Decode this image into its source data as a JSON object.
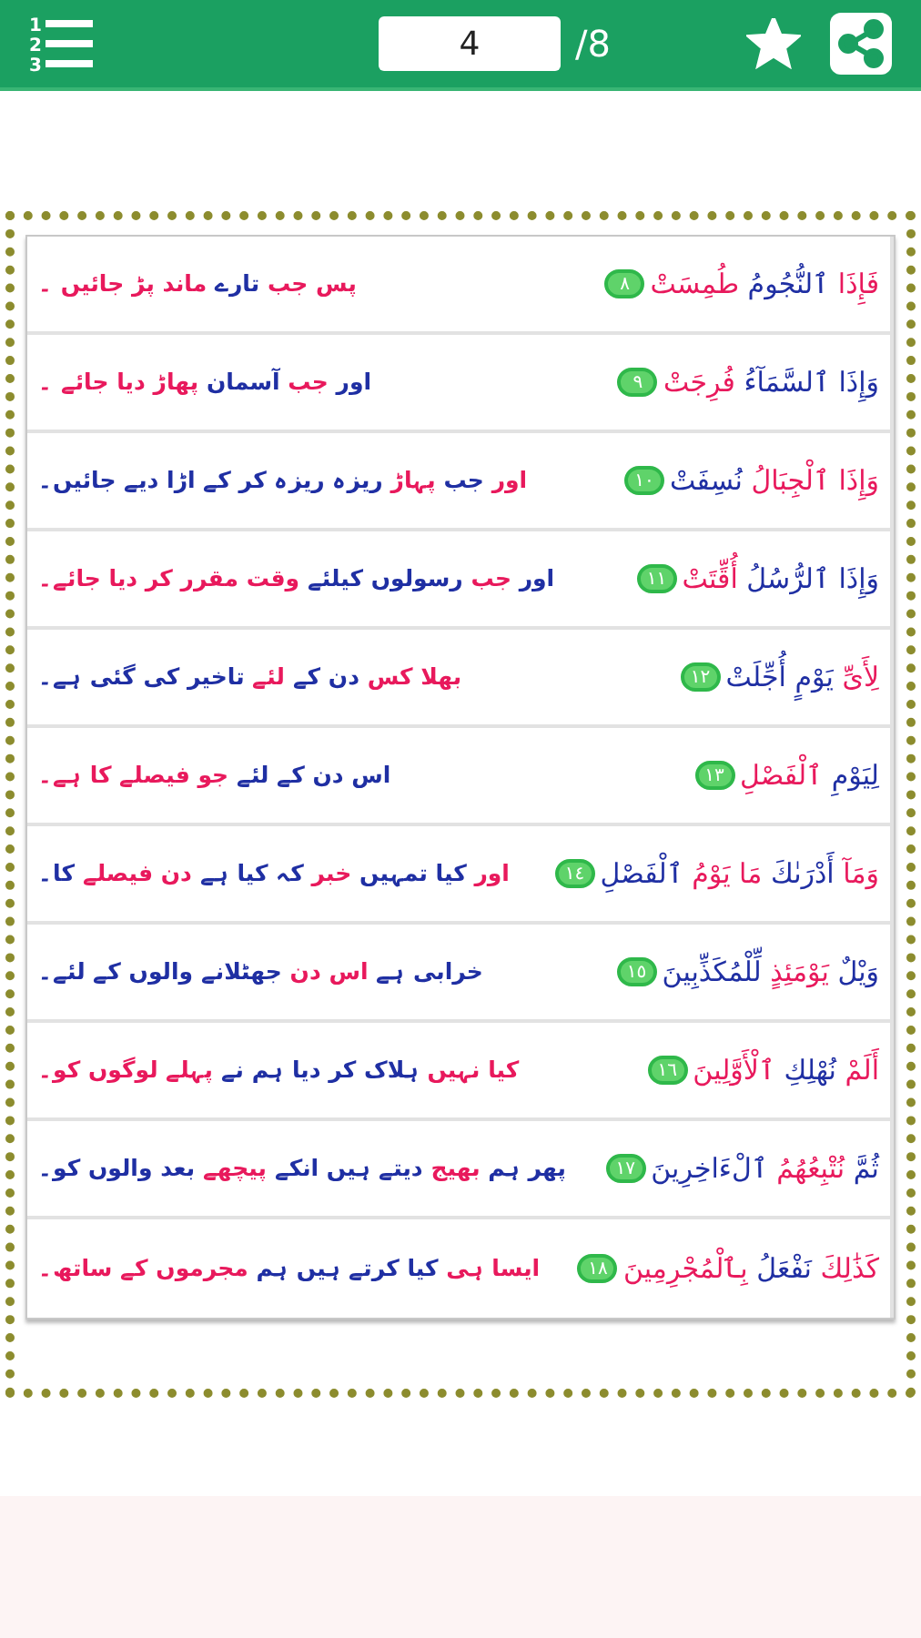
{
  "toolbar": {
    "menu_icon_digits": [
      "1",
      "2",
      "3"
    ],
    "page_field": {
      "value": "4"
    },
    "page_total": "/8",
    "favorite": {
      "on": true
    }
  },
  "verses": [
    {
      "number": "٨",
      "arabic": [
        {
          "text": "فَإِذَا",
          "color": "#e8195c"
        },
        {
          "text": "ٱلنُّجُومُ",
          "color": "#1f2fa3"
        },
        {
          "text": "طُمِسَتْ",
          "color": "#e8195c"
        }
      ],
      "urdu": [
        {
          "text": "پس جب",
          "color": "#e8195c"
        },
        {
          "text": "تارے",
          "color": "#1f2fa3"
        },
        {
          "text": "ماند پڑ جائیں ۔",
          "color": "#e8195c"
        }
      ]
    },
    {
      "number": "٩",
      "arabic": [
        {
          "text": "وَإِذَا",
          "color": "#1f2fa3"
        },
        {
          "text": "ٱلسَّمَآءُ",
          "color": "#1f2fa3"
        },
        {
          "text": "فُرِجَتْ",
          "color": "#e8195c"
        }
      ],
      "urdu": [
        {
          "text": "اور",
          "color": "#1f2fa3"
        },
        {
          "text": "جب",
          "color": "#e8195c"
        },
        {
          "text": "آسمان",
          "color": "#1f2fa3"
        },
        {
          "text": "پھاڑ دیا جائے ۔",
          "color": "#e8195c"
        }
      ]
    },
    {
      "number": "١٠",
      "arabic": [
        {
          "text": "وَإِذَا",
          "color": "#e8195c"
        },
        {
          "text": "ٱلْجِبَالُ",
          "color": "#e8195c"
        },
        {
          "text": "نُسِفَتْ",
          "color": "#1f2fa3"
        }
      ],
      "urdu": [
        {
          "text": "اور",
          "color": "#e8195c"
        },
        {
          "text": "جب",
          "color": "#1f2fa3"
        },
        {
          "text": "پہاڑ",
          "color": "#e8195c"
        },
        {
          "text": "ریزہ ریزہ کر کے اڑا دیے جائیں۔",
          "color": "#1f2fa3"
        }
      ]
    },
    {
      "number": "١١",
      "arabic": [
        {
          "text": "وَإِذَا",
          "color": "#1f2fa3"
        },
        {
          "text": "ٱلرُّسُلُ",
          "color": "#1f2fa3"
        },
        {
          "text": "أُقِّتَتْ",
          "color": "#e8195c"
        }
      ],
      "urdu": [
        {
          "text": "اور",
          "color": "#1f2fa3"
        },
        {
          "text": "جب",
          "color": "#e8195c"
        },
        {
          "text": "رسولوں کیلئے",
          "color": "#1f2fa3"
        },
        {
          "text": "وقت مقرر کر دیا جائے۔",
          "color": "#e8195c"
        }
      ]
    },
    {
      "number": "١٢",
      "arabic": [
        {
          "text": "لِأَىِّ",
          "color": "#e8195c"
        },
        {
          "text": "يَوْمٍ",
          "color": "#1f2fa3"
        },
        {
          "text": "أُجِّلَتْ",
          "color": "#1f2fa3"
        }
      ],
      "urdu": [
        {
          "text": "بھلا کس",
          "color": "#e8195c"
        },
        {
          "text": "دن کے",
          "color": "#1f2fa3"
        },
        {
          "text": "لئے",
          "color": "#e8195c"
        },
        {
          "text": "تاخیر کی گئی ہے۔",
          "color": "#1f2fa3"
        }
      ]
    },
    {
      "number": "١٣",
      "arabic": [
        {
          "text": "لِيَوْمِ",
          "color": "#1f2fa3"
        },
        {
          "text": "ٱلْفَصْلِ",
          "color": "#e8195c"
        }
      ],
      "urdu": [
        {
          "text": "اس دن کے لئے",
          "color": "#1f2fa3"
        },
        {
          "text": "جو فیصلے کا ہے۔",
          "color": "#e8195c"
        }
      ]
    },
    {
      "number": "١٤",
      "arabic": [
        {
          "text": "وَمَآ",
          "color": "#e8195c"
        },
        {
          "text": "أَدْرَىٰكَ",
          "color": "#1f2fa3"
        },
        {
          "text": "مَا يَوْمُ",
          "color": "#e8195c"
        },
        {
          "text": "ٱلْفَصْلِ",
          "color": "#1f2fa3"
        }
      ],
      "urdu": [
        {
          "text": "اور",
          "color": "#e8195c"
        },
        {
          "text": "کیا تمہیں",
          "color": "#1f2fa3"
        },
        {
          "text": "خبر",
          "color": "#e8195c"
        },
        {
          "text": "کہ کیا ہے",
          "color": "#1f2fa3"
        },
        {
          "text": "دن فیصلے",
          "color": "#e8195c"
        },
        {
          "text": "کا۔",
          "color": "#1f2fa3"
        }
      ]
    },
    {
      "number": "١٥",
      "arabic": [
        {
          "text": "وَيْلٌ",
          "color": "#1f2fa3"
        },
        {
          "text": "يَوْمَئِذٍ",
          "color": "#e8195c"
        },
        {
          "text": "لِّلْمُكَذِّبِينَ",
          "color": "#1f2fa3"
        }
      ],
      "urdu": [
        {
          "text": "خرابی ہے",
          "color": "#1f2fa3"
        },
        {
          "text": "اس دن",
          "color": "#e8195c"
        },
        {
          "text": "جھٹلانے والوں کے لئے۔",
          "color": "#1f2fa3"
        }
      ]
    },
    {
      "number": "١٦",
      "arabic": [
        {
          "text": "أَلَمْ",
          "color": "#e8195c"
        },
        {
          "text": "نُهْلِكِ",
          "color": "#1f2fa3"
        },
        {
          "text": "ٱلْأَوَّلِينَ",
          "color": "#e8195c"
        }
      ],
      "urdu": [
        {
          "text": "کیا نہیں",
          "color": "#e8195c"
        },
        {
          "text": "ہلاک کر دیا ہم نے",
          "color": "#1f2fa3"
        },
        {
          "text": "پہلے لوگوں کو۔",
          "color": "#e8195c"
        }
      ]
    },
    {
      "number": "١٧",
      "arabic": [
        {
          "text": "ثُمَّ",
          "color": "#1f2fa3"
        },
        {
          "text": "نُتْبِعُهُمُ",
          "color": "#e8195c"
        },
        {
          "text": "ٱلْءَاخِرِينَ",
          "color": "#1f2fa3"
        }
      ],
      "urdu": [
        {
          "text": "پھر ہم",
          "color": "#1f2fa3"
        },
        {
          "text": "بھیج",
          "color": "#e8195c"
        },
        {
          "text": "دیتے ہیں انکے",
          "color": "#1f2fa3"
        },
        {
          "text": "پیچھے",
          "color": "#e8195c"
        },
        {
          "text": "بعد والوں کو۔",
          "color": "#1f2fa3"
        }
      ]
    },
    {
      "number": "١٨",
      "arabic": [
        {
          "text": "كَذَٰلِكَ",
          "color": "#e8195c"
        },
        {
          "text": "نَفْعَلُ",
          "color": "#1f2fa3"
        },
        {
          "text": "بِٱلْمُجْرِمِينَ",
          "color": "#e8195c"
        }
      ],
      "urdu": [
        {
          "text": "ایسا ہی",
          "color": "#e8195c"
        },
        {
          "text": "کیا کرتے ہیں ہم",
          "color": "#1f2fa3"
        },
        {
          "text": "مجرموں کے ساتھ۔",
          "color": "#e8195c"
        }
      ]
    }
  ]
}
